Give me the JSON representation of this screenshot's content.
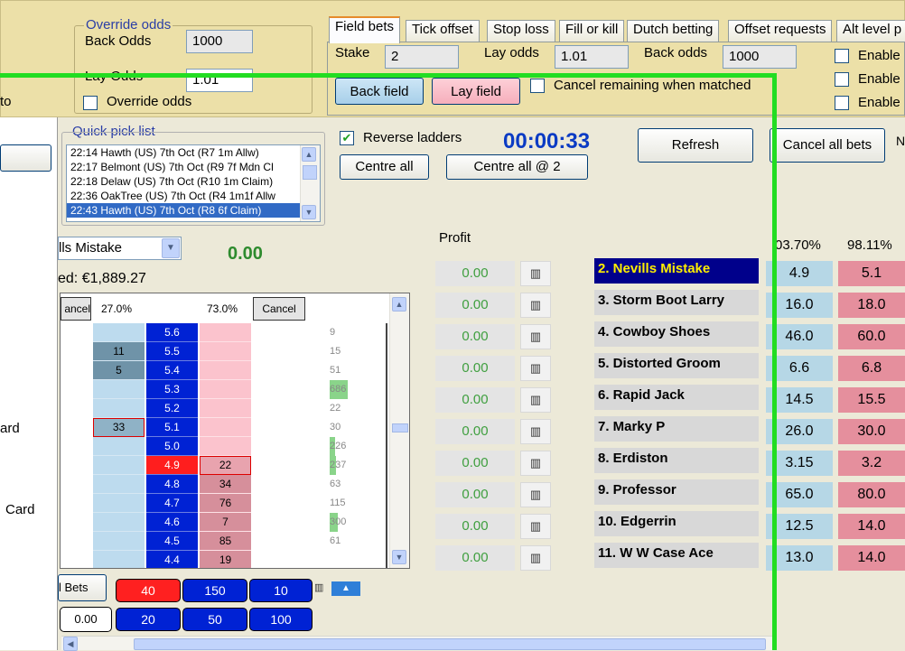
{
  "override": {
    "title": "Override odds",
    "back_label": "Back Odds",
    "back_value": "1000",
    "lay_label": "Lay Odds",
    "lay_value": "1.01",
    "checkbox_label": "Override odds",
    "left_fragment": "to"
  },
  "tabs": [
    "Field bets",
    "Tick offset",
    "Stop loss",
    "Fill or kill",
    "Dutch betting",
    "Offset requests",
    "Alt level p"
  ],
  "field_bets": {
    "stake_label": "Stake",
    "stake_value": "2",
    "lay_odds_label": "Lay odds",
    "lay_odds_value": "1.01",
    "back_odds_label": "Back odds",
    "back_odds_value": "1000",
    "back_field": "Back field",
    "lay_field": "Lay field",
    "cancel_remaining": "Cancel remaining when matched",
    "enable": [
      "Enable",
      "Enable",
      "Enable"
    ]
  },
  "quick_pick": {
    "title": "Quick pick list",
    "items": [
      "22:14 Hawth (US) 7th Oct (R7 1m Allw)",
      "22:17 Belmont (US) 7th Oct (R9 7f Mdn Cl",
      "22:18 Delaw (US) 7th Oct (R10 1m Claim)",
      "22:36 OakTree (US) 7th Oct (R4 1m1f Allw",
      "22:43 Hawth (US) 7th Oct (R8 6f Claim)"
    ],
    "selected_index": 4
  },
  "controls": {
    "reverse_ladders": "Reverse ladders",
    "timer": "00:00:33",
    "refresh": "Refresh",
    "cancel_all_bets": "Cancel all bets",
    "centre_all": "Centre all",
    "centre_all_at": "Centre all @ 2",
    "edge_char": "N"
  },
  "ladder": {
    "runner_select": "lls Mistake",
    "runner_profit": "0.00",
    "matched_label": "ed: €1,889.27",
    "cancel_left": "ancel",
    "cancel_right": "Cancel",
    "back_pct": "27.0%",
    "lay_pct": "73.0%",
    "rows": [
      {
        "price": "5.6",
        "back": "",
        "lay": "",
        "vol": "9"
      },
      {
        "price": "5.5",
        "back": "11",
        "lay": "",
        "vol": "15"
      },
      {
        "price": "5.4",
        "back": "5",
        "lay": "",
        "vol": "51"
      },
      {
        "price": "5.3",
        "back": "",
        "lay": "",
        "vol": "686"
      },
      {
        "price": "5.2",
        "back": "",
        "lay": "",
        "vol": "22"
      },
      {
        "price": "5.1",
        "back": "33",
        "lay": "",
        "vol": "30"
      },
      {
        "price": "5.0",
        "back": "",
        "lay": "",
        "vol": "226"
      },
      {
        "price": "4.9",
        "back": "",
        "lay": "22",
        "vol": "237"
      },
      {
        "price": "4.8",
        "back": "",
        "lay": "34",
        "vol": "63"
      },
      {
        "price": "4.7",
        "back": "",
        "lay": "76",
        "vol": "115"
      },
      {
        "price": "4.6",
        "back": "",
        "lay": "7",
        "vol": "300"
      },
      {
        "price": "4.5",
        "back": "",
        "lay": "85",
        "vol": "61"
      },
      {
        "price": "4.4",
        "back": "",
        "lay": "19",
        "vol": ""
      }
    ],
    "bets_label": "l Bets",
    "bets_value": "0.00",
    "stakes_top": [
      "40",
      "150",
      "10"
    ],
    "stakes_bottom": [
      "20",
      "50",
      "100"
    ]
  },
  "left_panel": {
    "frag1": "ard",
    "frag2": "Card"
  },
  "market": {
    "profit_header": "Profit",
    "back_pct": "03.70%",
    "lay_pct": "98.11%",
    "runners": [
      {
        "name": "2. Nevills Mistake",
        "profit": "0.00",
        "back": "4.9",
        "lay": "5.1"
      },
      {
        "name": "3. Storm Boot Larry",
        "profit": "0.00",
        "back": "16.0",
        "lay": "18.0"
      },
      {
        "name": "4. Cowboy Shoes",
        "profit": "0.00",
        "back": "46.0",
        "lay": "60.0"
      },
      {
        "name": "5. Distorted Groom",
        "profit": "0.00",
        "back": "6.6",
        "lay": "6.8"
      },
      {
        "name": "6. Rapid Jack",
        "profit": "0.00",
        "back": "14.5",
        "lay": "15.5"
      },
      {
        "name": "7. Marky P",
        "profit": "0.00",
        "back": "26.0",
        "lay": "30.0"
      },
      {
        "name": "8. Erdiston",
        "profit": "0.00",
        "back": "3.15",
        "lay": "3.2"
      },
      {
        "name": "9. Professor",
        "profit": "0.00",
        "back": "65.0",
        "lay": "80.0"
      },
      {
        "name": "10. Edgerrin",
        "profit": "0.00",
        "back": "12.5",
        "lay": "14.0"
      },
      {
        "name": "11. W W Case Ace",
        "profit": "0.00",
        "back": "13.0",
        "lay": "14.0"
      }
    ]
  },
  "colors": {
    "highlight_frame": "#22dd22",
    "price_blue": "#0022d4",
    "lay_pink": "#fbc3cd",
    "back_blue": "#bddbee"
  },
  "icons": [
    "chart-icon",
    "checkbox-icon",
    "chevron-down-icon",
    "chevron-up-icon",
    "triangle-up-icon"
  ]
}
